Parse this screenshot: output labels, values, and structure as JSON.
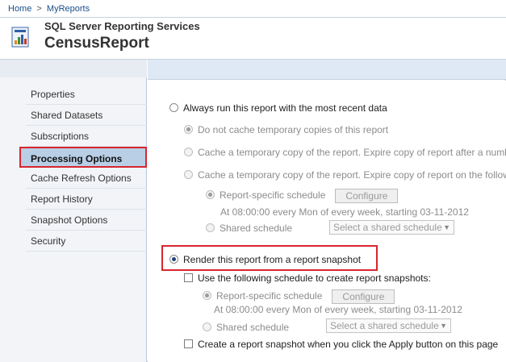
{
  "breadcrumb": {
    "home": "Home",
    "separator": ">",
    "current": "MyReports"
  },
  "header": {
    "app_title": "SQL Server Reporting Services",
    "report_title": "CensusReport"
  },
  "sidebar": {
    "items": [
      {
        "label": "Properties"
      },
      {
        "label": "Shared Datasets"
      },
      {
        "label": "Subscriptions"
      },
      {
        "label": "Processing Options",
        "active": true
      },
      {
        "label": "Cache Refresh Options"
      },
      {
        "label": "Report History"
      },
      {
        "label": "Snapshot Options"
      },
      {
        "label": "Security"
      }
    ]
  },
  "options": {
    "always_run": "Always run this report with the most recent data",
    "no_cache": "Do not cache temporary copies of this report",
    "cache_expire_after": "Cache a temporary copy of the report. Expire copy of report after a numbe",
    "cache_expire_schedule": "Cache a temporary copy of the report. Expire copy of report on the followin",
    "report_specific_schedule": "Report-specific schedule",
    "configure": "Configure",
    "schedule_desc": "At 08:00:00 every Mon of every week, starting 03-11-2012",
    "shared_schedule": "Shared schedule",
    "select_shared_schedule": "Select a shared schedule",
    "render_snapshot": "Render this report from a report snapshot",
    "use_schedule_snapshots": "Use the following schedule to create report snapshots:",
    "snapshot_report_specific": "Report-specific schedule",
    "snapshot_configure": "Configure",
    "snapshot_schedule_desc": "At 08:00:00 every Mon of every week, starting 03-11-2012",
    "snapshot_shared_schedule": "Shared schedule",
    "snapshot_select_shared": "Select a shared schedule",
    "create_on_apply": "Create a report snapshot when you click the Apply button on this page"
  },
  "colors": {
    "highlight": "#d8262f",
    "active_nav": "#b8cfe6",
    "link": "#1a4f8b"
  }
}
